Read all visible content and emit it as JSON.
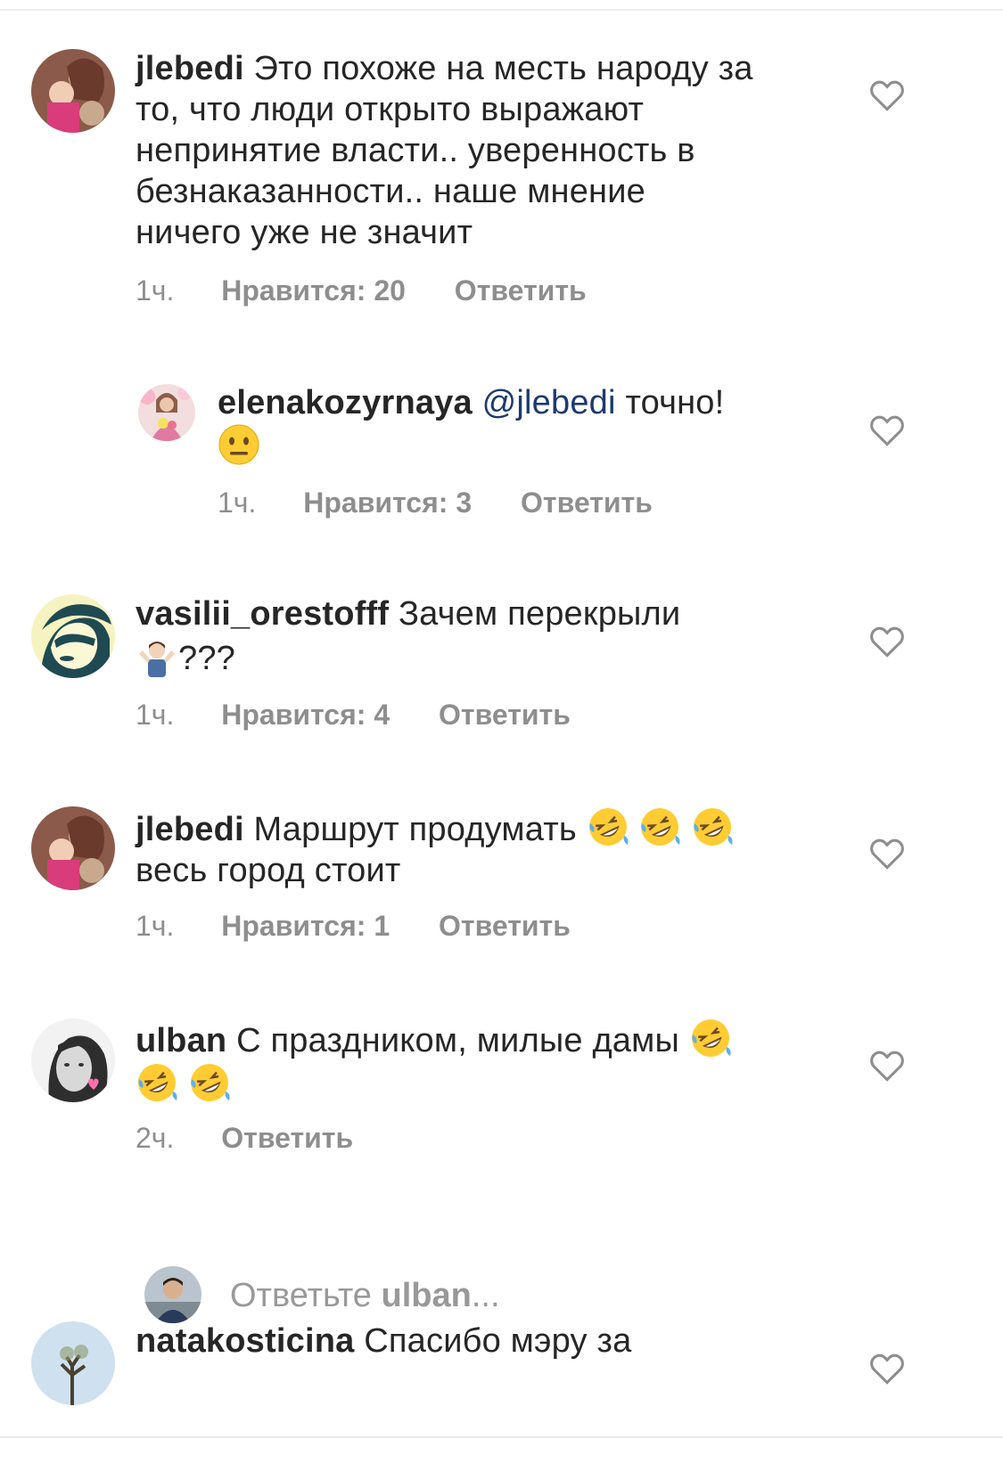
{
  "comments": [
    {
      "username": "jlebedi",
      "text_lines": [
        "Это похоже на месть народу за",
        "то, что люди открыто выражают",
        "непринятие власти.. уверенность в",
        "безнаказанности.. наше мнение",
        "ничего уже не значит"
      ],
      "time": "1ч.",
      "likes": "Нравится: 20",
      "reply": "Ответить",
      "heart_icon": "heart-outline-icon"
    },
    {
      "username": "elenakozyrnaya",
      "mention": "@jlebedi",
      "text": "точно!",
      "emoji": "neutral-face-emoji",
      "time": "1ч.",
      "likes": "Нравится: 3",
      "reply": "Ответить",
      "heart_icon": "heart-outline-icon"
    },
    {
      "username": "vasilii_orestofff",
      "text": "Зачем перекрыли",
      "emoji": "person-shrugging-emoji",
      "text_after_emoji": "???",
      "time": "1ч.",
      "likes": "Нравится: 4",
      "reply": "Ответить",
      "heart_icon": "heart-outline-icon"
    },
    {
      "username": "jlebedi",
      "text": "Маршрут продумать",
      "emoji": "rolling-on-floor-laughing-emoji",
      "text_line2": "весь город стоит",
      "time": "1ч.",
      "likes": "Нравится: 1",
      "reply": "Ответить",
      "heart_icon": "heart-outline-icon"
    },
    {
      "username": "ulban",
      "text": "С праздником, милые дамы",
      "emoji": "rolling-on-floor-laughing-emoji",
      "time": "2ч.",
      "reply": "Ответить",
      "heart_icon": "heart-outline-icon"
    },
    {
      "username": "natakosticina",
      "text": "Спасибо мэру за",
      "heart_icon": "heart-outline-icon"
    }
  ],
  "reply_input": {
    "prefix": "Ответьте",
    "username": "ulban",
    "suffix": "..."
  },
  "colors": {
    "text": "#262626",
    "meta": "#8e8e8e",
    "mention": "#1d3a6e",
    "placeholder": "#999999"
  }
}
